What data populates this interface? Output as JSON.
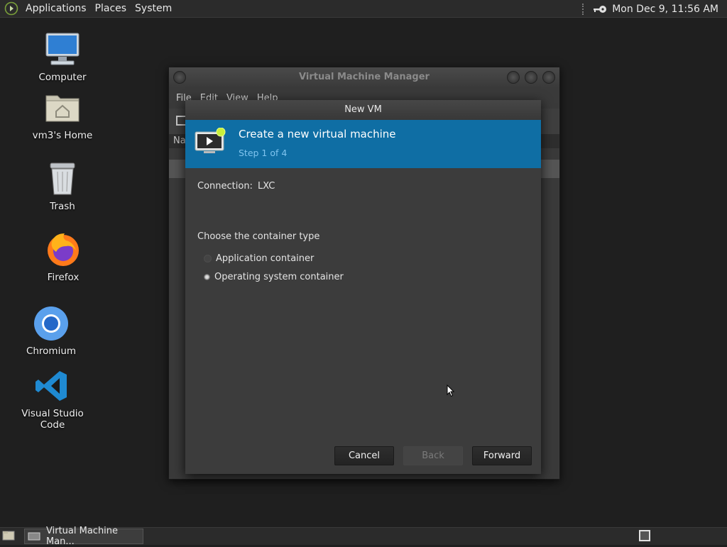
{
  "top_panel": {
    "menus": [
      "Applications",
      "Places",
      "System"
    ],
    "clock": "Mon Dec  9, 11:56 AM"
  },
  "desktop": {
    "icons": [
      {
        "label": "Computer",
        "icon": "computer-icon"
      },
      {
        "label": "vm3's Home",
        "icon": "home-folder-icon"
      },
      {
        "label": "Trash",
        "icon": "trash-icon"
      },
      {
        "label": "Firefox",
        "icon": "firefox-icon"
      },
      {
        "label": "Chromium",
        "icon": "chromium-icon"
      },
      {
        "label": "Visual Studio Code",
        "icon": "vscode-icon"
      }
    ]
  },
  "vmm_window": {
    "title": "Virtual Machine Manager",
    "menu": [
      "File",
      "Edit",
      "View",
      "Help"
    ],
    "column_header": "Na"
  },
  "dialog": {
    "title": "New VM",
    "header_title": "Create a new virtual machine",
    "header_step": "Step 1 of 4",
    "connection_label": "Connection:",
    "connection_value": "LXC",
    "section_label": "Choose the container type",
    "options": [
      {
        "label": "Application container",
        "selected": false
      },
      {
        "label": "Operating system container",
        "selected": true
      }
    ],
    "buttons": {
      "cancel": "Cancel",
      "back": "Back",
      "forward": "Forward"
    }
  },
  "taskbar": {
    "tasks": [
      "Virtual Machine Man..."
    ]
  },
  "colors": {
    "header_blue": "#0f6ea4",
    "step_text": "#7fc4ef"
  }
}
